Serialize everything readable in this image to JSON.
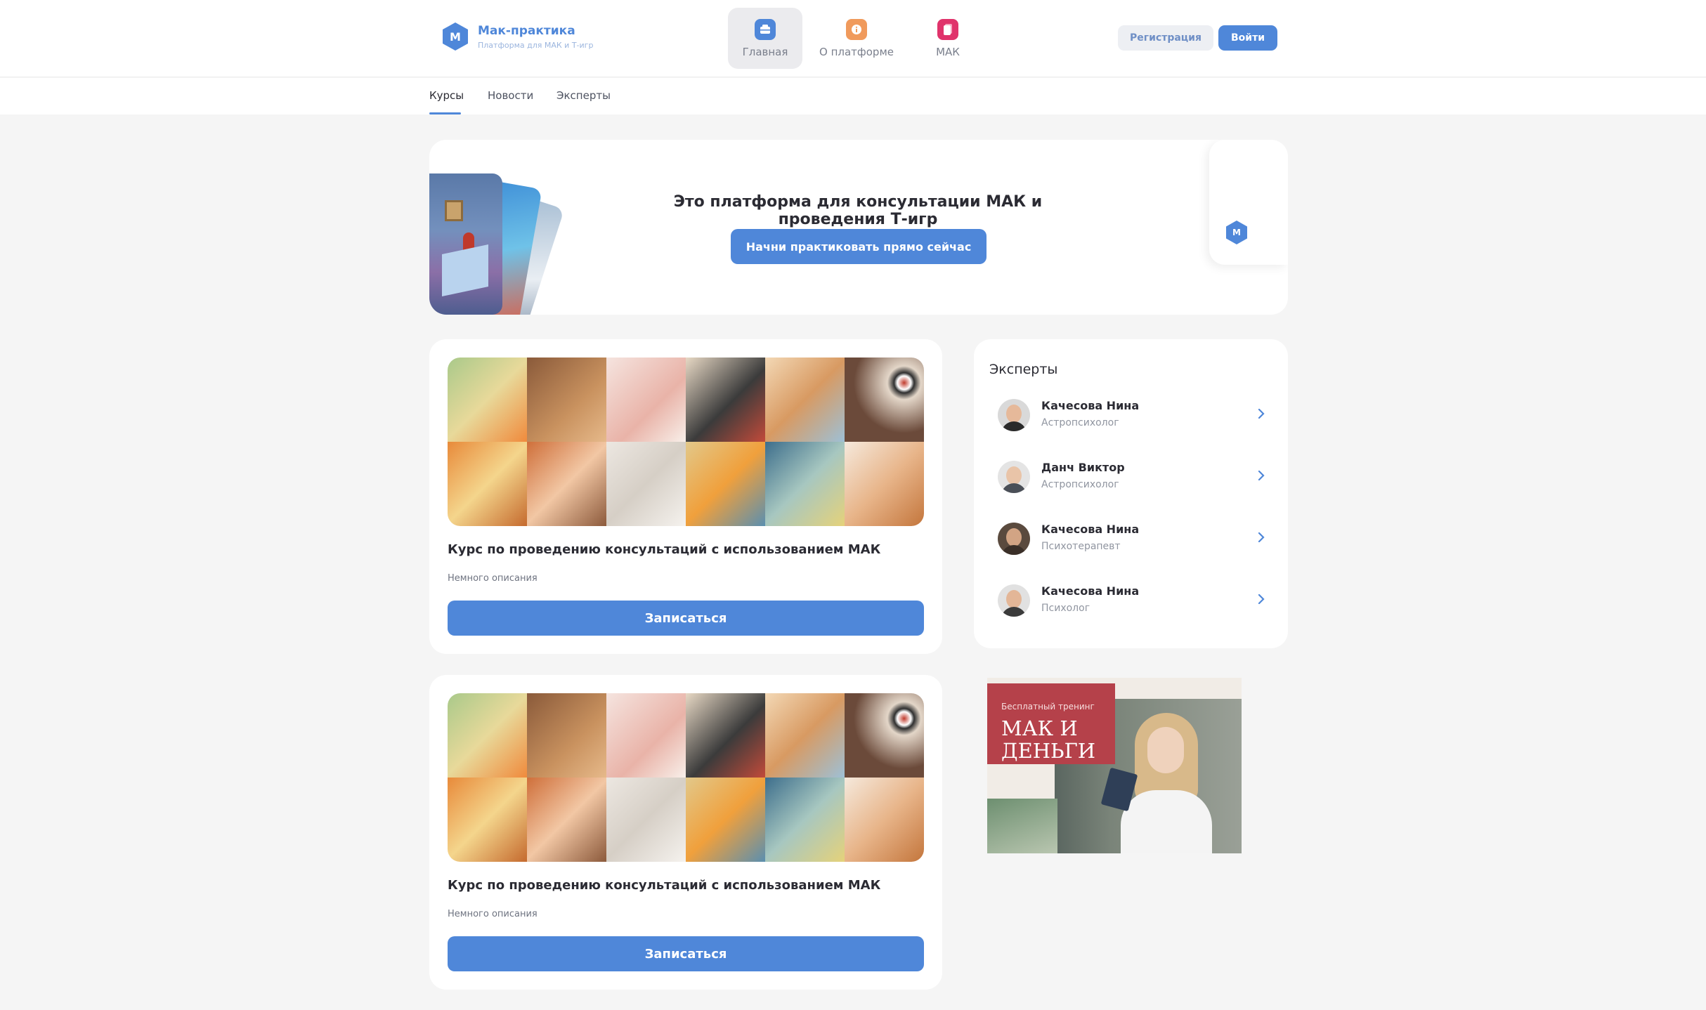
{
  "header": {
    "logo_letter": "M",
    "logo_title": "Мак-практика",
    "logo_subtitle": "Платформа для МАК и Т-игр",
    "nav": [
      {
        "label": "Главная",
        "icon": "home-icon",
        "active": true
      },
      {
        "label": "О платформе",
        "icon": "info-icon",
        "active": false
      },
      {
        "label": "МАК",
        "icon": "cards-icon",
        "active": false
      }
    ],
    "register_label": "Регистрация",
    "login_label": "Войти"
  },
  "subnav": {
    "tabs": [
      {
        "label": "Курсы",
        "active": true
      },
      {
        "label": "Новости",
        "active": false
      },
      {
        "label": "Эксперты",
        "active": false
      }
    ]
  },
  "hero": {
    "title": "Это платформа для консультации МАК и проведения Т-игр",
    "button_label": "Начни практиковать прямо сейчас",
    "side_logo_letter": "M"
  },
  "courses": [
    {
      "title": "Курс по проведению консультаций с использованием МАК",
      "description": "Немного описания",
      "button_label": "Записаться"
    },
    {
      "title": "Курс по проведению консультаций с использованием МАК",
      "description": "Немного описания",
      "button_label": "Записаться"
    }
  ],
  "experts": {
    "title": "Эксперты",
    "items": [
      {
        "name": "Качесова Нина",
        "role": "Астропсихолог"
      },
      {
        "name": "Данч Виктор",
        "role": "Астропсихолог"
      },
      {
        "name": "Качесова Нина",
        "role": "Психотерапевт"
      },
      {
        "name": "Качесова Нина",
        "role": "Психолог"
      }
    ]
  },
  "banner": {
    "tag": "Бесплатный тренинг",
    "title": "МАК И ДЕНЬГИ"
  },
  "colors": {
    "accent": "#4f87d9",
    "background": "#f5f5f5",
    "banner_red": "#b5414a"
  }
}
